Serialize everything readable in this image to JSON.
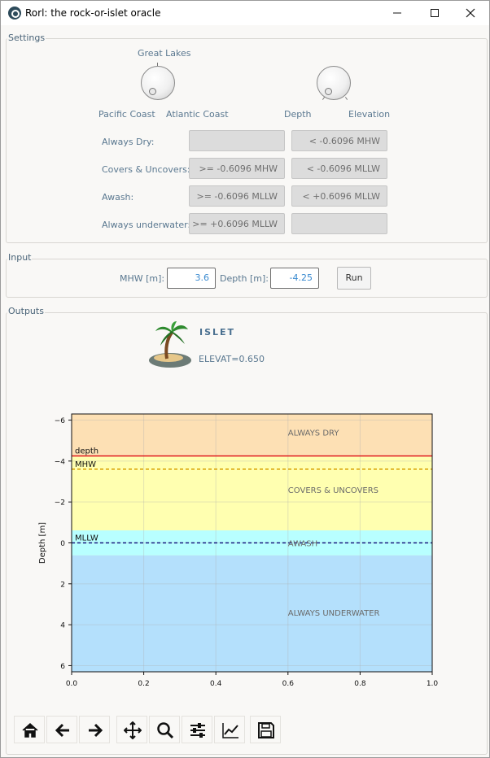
{
  "window": {
    "title": "Rorl: the rock-or-islet oracle",
    "controls": {
      "minimize": "—",
      "maximize": "☐",
      "close": "✕"
    }
  },
  "settings": {
    "group_title": "Settings",
    "region_dial": {
      "top": "Great Lakes",
      "left": "Pacific Coast",
      "right": "Atlantic Coast"
    },
    "mode_dial": {
      "left": "Depth",
      "right": "Elevation"
    },
    "rows": [
      {
        "label": "Always Dry:",
        "lower": "",
        "upper": "< -0.6096 MHW"
      },
      {
        "label": "Covers & Uncovers:",
        "lower": ">= -0.6096 MHW",
        "upper": "< -0.6096 MLLW"
      },
      {
        "label": "Awash:",
        "lower": ">= -0.6096 MLLW",
        "upper": "< +0.6096 MLLW"
      },
      {
        "label": "Always underwater:",
        "lower": ">= +0.6096 MLLW",
        "upper": ""
      }
    ]
  },
  "input": {
    "group_title": "Input",
    "mhw_label": "MHW [m]:",
    "mhw_value": "3.6",
    "depth_label": "Depth [m]:",
    "depth_value": "-4.25",
    "run_label": "Run"
  },
  "outputs": {
    "group_title": "Outputs",
    "result_title": "ISLET",
    "result_detail": "ELEVAT=0.650",
    "result_icon": "palm-island-icon"
  },
  "chart_data": {
    "type": "area",
    "ylabel": "Depth [m]",
    "xlabel": "",
    "xlim": [
      0.0,
      1.0
    ],
    "ylim": [
      6.3,
      -6.3
    ],
    "y_inverted": true,
    "xticks": [
      "0.0",
      "0.2",
      "0.4",
      "0.6",
      "0.8",
      "1.0"
    ],
    "yticks": [
      "−6",
      "−4",
      "−2",
      "0",
      "2",
      "4",
      "6"
    ],
    "grid": true,
    "bands": [
      {
        "name": "ALWAYS DRY",
        "from": -6.3,
        "to": -4.21,
        "color": "#fde0b4"
      },
      {
        "name": "COVERS & UNCOVERS",
        "from": -4.21,
        "to": 0.61,
        "color": "#ffffb0"
      },
      {
        "name": "AWASH",
        "from": 0.61,
        "to": 0.61,
        "color": "#b8ffff"
      },
      {
        "name": "ALWAYS UNDERWATER",
        "from": 0.61,
        "to": 6.3,
        "color": "#b4e0fc"
      }
    ],
    "band_labels": [
      {
        "text": "ALWAYS DRY",
        "x": 0.6,
        "y": -5.4
      },
      {
        "text": "COVERS & UNCOVERS",
        "x": 0.6,
        "y": -2.6
      },
      {
        "text": "AWASH",
        "x": 0.6,
        "y": 0.0
      },
      {
        "text": "ALWAYS UNDERWATER",
        "x": 0.6,
        "y": 3.4
      }
    ],
    "lines": [
      {
        "name": "depth",
        "y": -4.25,
        "color": "#e02020",
        "style": "solid"
      },
      {
        "name": "MHW",
        "y": -3.6,
        "color": "#d8a000",
        "style": "dashed"
      },
      {
        "name": "MLLW",
        "y": 0.0,
        "color": "#1a1a80",
        "style": "dashed"
      }
    ]
  },
  "toolbar": {
    "buttons": [
      {
        "name": "home",
        "icon": "home-icon"
      },
      {
        "name": "back",
        "icon": "arrow-left-icon"
      },
      {
        "name": "forward",
        "icon": "arrow-right-icon"
      },
      {
        "name": "pan",
        "icon": "move-icon"
      },
      {
        "name": "zoom",
        "icon": "zoom-icon"
      },
      {
        "name": "subplots",
        "icon": "sliders-icon"
      },
      {
        "name": "customize",
        "icon": "line-chart-icon"
      },
      {
        "name": "save",
        "icon": "save-icon"
      }
    ]
  }
}
